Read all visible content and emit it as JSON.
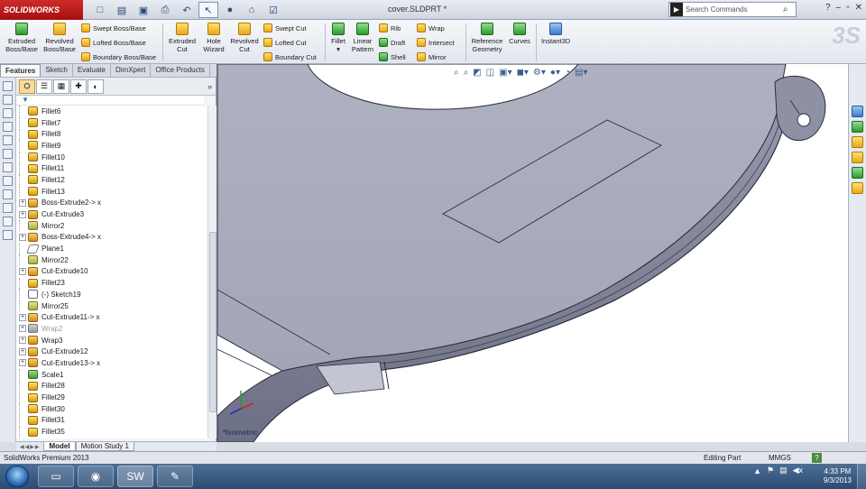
{
  "app": {
    "logo": "SOLIDWORKS",
    "doc_title": "cover.SLDPRT *",
    "search_placeholder": "Search Commands"
  },
  "ribbon": {
    "extruded_boss": "Extruded Boss/Base",
    "revolved_boss": "Revolved Boss/Base",
    "swept_boss": "Swept Boss/Base",
    "lofted_boss": "Lofted Boss/Base",
    "boundary_boss": "Boundary Boss/Base",
    "extruded_cut": "Extruded Cut",
    "hole_wizard": "Hole Wizard",
    "revolved_cut": "Revolved Cut",
    "swept_cut": "Swept Cut",
    "lofted_cut": "Lofted Cut",
    "boundary_cut": "Boundary Cut",
    "fillet": "Fillet",
    "linear_pattern": "Linear Pattern",
    "rib": "Rib",
    "draft": "Draft",
    "shell": "Shell",
    "wrap": "Wrap",
    "intersect": "Intersect",
    "mirror": "Mirror",
    "reference_geometry": "Reference Geometry",
    "curves": "Curves",
    "instant3d": "Instant3D"
  },
  "tabs": [
    "Features",
    "Sketch",
    "Evaluate",
    "DimXpert",
    "Office Products"
  ],
  "tree": [
    {
      "label": "Fillet6",
      "icon": "fillet",
      "expandable": false
    },
    {
      "label": "Fillet7",
      "icon": "fillet",
      "expandable": false
    },
    {
      "label": "Fillet8",
      "icon": "fillet",
      "expandable": false
    },
    {
      "label": "Fillet9",
      "icon": "fillet",
      "expandable": false
    },
    {
      "label": "Fillet10",
      "icon": "fillet",
      "expandable": false
    },
    {
      "label": "Fillet11",
      "icon": "fillet",
      "expandable": false
    },
    {
      "label": "Fillet12",
      "icon": "fillet",
      "expandable": false
    },
    {
      "label": "Fillet13",
      "icon": "fillet",
      "expandable": false
    },
    {
      "label": "Boss-Extrude2-> x",
      "icon": "extrude",
      "expandable": true
    },
    {
      "label": "Cut-Extrude3",
      "icon": "extrude",
      "expandable": true
    },
    {
      "label": "Mirror2",
      "icon": "mirror",
      "expandable": false
    },
    {
      "label": "Boss-Extrude4-> x",
      "icon": "extrude",
      "expandable": true
    },
    {
      "label": "Plane1",
      "icon": "plane",
      "expandable": false
    },
    {
      "label": "Mirror22",
      "icon": "mirror",
      "expandable": false
    },
    {
      "label": "Cut-Extrude10",
      "icon": "extrude",
      "expandable": true
    },
    {
      "label": "Fillet23",
      "icon": "fillet",
      "expandable": false
    },
    {
      "label": "(-) Sketch19",
      "icon": "sketch",
      "expandable": false
    },
    {
      "label": "Mirror25",
      "icon": "mirror",
      "expandable": false
    },
    {
      "label": "Cut-Extrude11-> x",
      "icon": "extrude",
      "expandable": true
    },
    {
      "label": "Wrap2",
      "icon": "wrap",
      "expandable": true,
      "dim": true
    },
    {
      "label": "Wrap3",
      "icon": "wrap2",
      "expandable": true
    },
    {
      "label": "Cut-Extrude12",
      "icon": "extrude",
      "expandable": true
    },
    {
      "label": "Cut-Extrude13-> x",
      "icon": "extrude",
      "expandable": true
    },
    {
      "label": "Scale1",
      "icon": "scale",
      "expandable": false
    },
    {
      "label": "Fillet28",
      "icon": "fillet",
      "expandable": false
    },
    {
      "label": "Fillet29",
      "icon": "fillet",
      "expandable": false
    },
    {
      "label": "Fillet30",
      "icon": "fillet",
      "expandable": false
    },
    {
      "label": "Fillet31",
      "icon": "fillet",
      "expandable": false
    },
    {
      "label": "Fillet35",
      "icon": "fillet",
      "expandable": false
    }
  ],
  "model_tabs": [
    "Model",
    "Motion Study 1"
  ],
  "viewport": {
    "view_label": "*Isometric"
  },
  "status": {
    "product": "SolidWorks Premium 2013",
    "mode": "Editing Part",
    "units": "MMGS",
    "help": "?"
  },
  "taskbar": {
    "time": "4:33 PM",
    "date": "9/3/2013"
  },
  "colors": {
    "brand_red": "#c41f1f",
    "model_face": "#a8abba",
    "model_edge": "#2a2d40"
  }
}
